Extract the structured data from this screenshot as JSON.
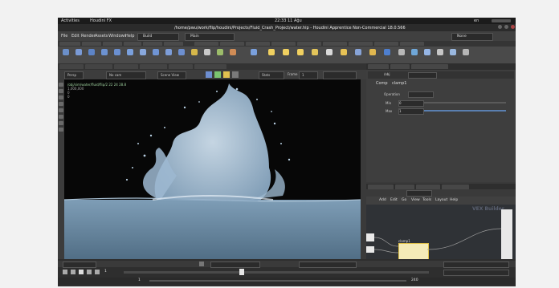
{
  "topbar": {
    "activities": "Activities",
    "app": "Houdini FX",
    "clock": "22:33 11 Ağu",
    "lang": "en"
  },
  "titlebar": {
    "title": "/home/pwu/work/flip/houdini/Projects/Fluid_Crash_Project/water.hip - Houdini Apprentice Non-Commercial 18.0.566"
  },
  "menubar": {
    "items": [
      "File",
      "Edit",
      "Render",
      "Assets",
      "Windows",
      "Help"
    ],
    "build": "Build",
    "main": "Main",
    "desktop": "None"
  },
  "viewport_toolbar": {
    "pane": "Persp",
    "camera": "No cam",
    "frame_label": "Frame",
    "frame_value": "1",
    "scene": "Scene View",
    "stats": "Stats"
  },
  "viewport": {
    "info_lines": [
      "/obj/sim/water/fluid/flip/2 22 24 28.8",
      "1,000,000",
      "0",
      "0"
    ],
    "colors": {
      "water": "#6f8fa8",
      "splash": "#a9c3d8",
      "bg": "#070707"
    }
  },
  "parameters": {
    "node_title": "Comp",
    "node_name": "clamp1",
    "group_label": "Operation",
    "fields": [
      {
        "label": "Min",
        "value": "0"
      },
      {
        "label": "Max",
        "value": "1"
      }
    ]
  },
  "network": {
    "path": "/obj",
    "node_label": "clamp1",
    "menus": [
      "Add",
      "Edit",
      "Go",
      "View",
      "Tools",
      "Layout",
      "Help"
    ],
    "watermark": "VEX Builder"
  },
  "timeline": {
    "start": "1",
    "end": "240",
    "current": "1",
    "fps": "24"
  }
}
